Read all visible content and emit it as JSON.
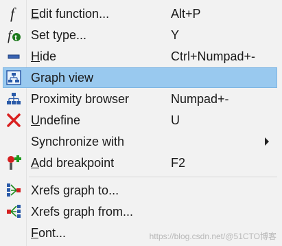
{
  "menu": {
    "items": [
      {
        "label": "Edit function...",
        "mnemonic": "E",
        "rest": "dit function...",
        "shortcut": "Alt+P",
        "icon": "function-f-icon"
      },
      {
        "label": "Set type...",
        "mnemonic": "",
        "rest": "Set type...",
        "shortcut": "Y",
        "icon": "set-type-icon"
      },
      {
        "label": "Hide",
        "mnemonic": "H",
        "rest": "ide",
        "shortcut": "Ctrl+Numpad+-",
        "icon": "minus-icon"
      },
      {
        "label": "Graph view",
        "mnemonic": "",
        "rest": "Graph view",
        "shortcut": "",
        "icon": "graph-view-icon",
        "selected": true
      },
      {
        "label": "Proximity browser",
        "mnemonic": "",
        "rest": "Proximity browser",
        "shortcut": "Numpad+-",
        "icon": "proximity-tree-icon"
      },
      {
        "label": "Undefine",
        "mnemonic": "U",
        "rest": "ndefine",
        "shortcut": "U",
        "icon": "red-x-icon"
      },
      {
        "label": "Synchronize with",
        "mnemonic": "",
        "rest": "Synchronize with",
        "shortcut": "",
        "icon": "",
        "submenu": true
      },
      {
        "label": "Add breakpoint",
        "mnemonic": "A",
        "rest": "dd breakpoint",
        "shortcut": "F2",
        "icon": "breakpoint-icon"
      },
      {
        "label": "Xrefs graph to...",
        "mnemonic": "",
        "rest": "Xrefs graph to...",
        "shortcut": "",
        "icon": "xrefs-to-icon"
      },
      {
        "label": "Xrefs graph from...",
        "mnemonic": "",
        "rest": "Xrefs graph from...",
        "shortcut": "",
        "icon": "xrefs-from-icon"
      },
      {
        "label": "Font...",
        "mnemonic": "F",
        "rest": "ont...",
        "shortcut": "",
        "icon": ""
      }
    ]
  },
  "watermark": "https://blog.csdn.net/@51CTO博客",
  "colors": {
    "selection": "#99c9ef",
    "background": "#f2f2f2"
  }
}
